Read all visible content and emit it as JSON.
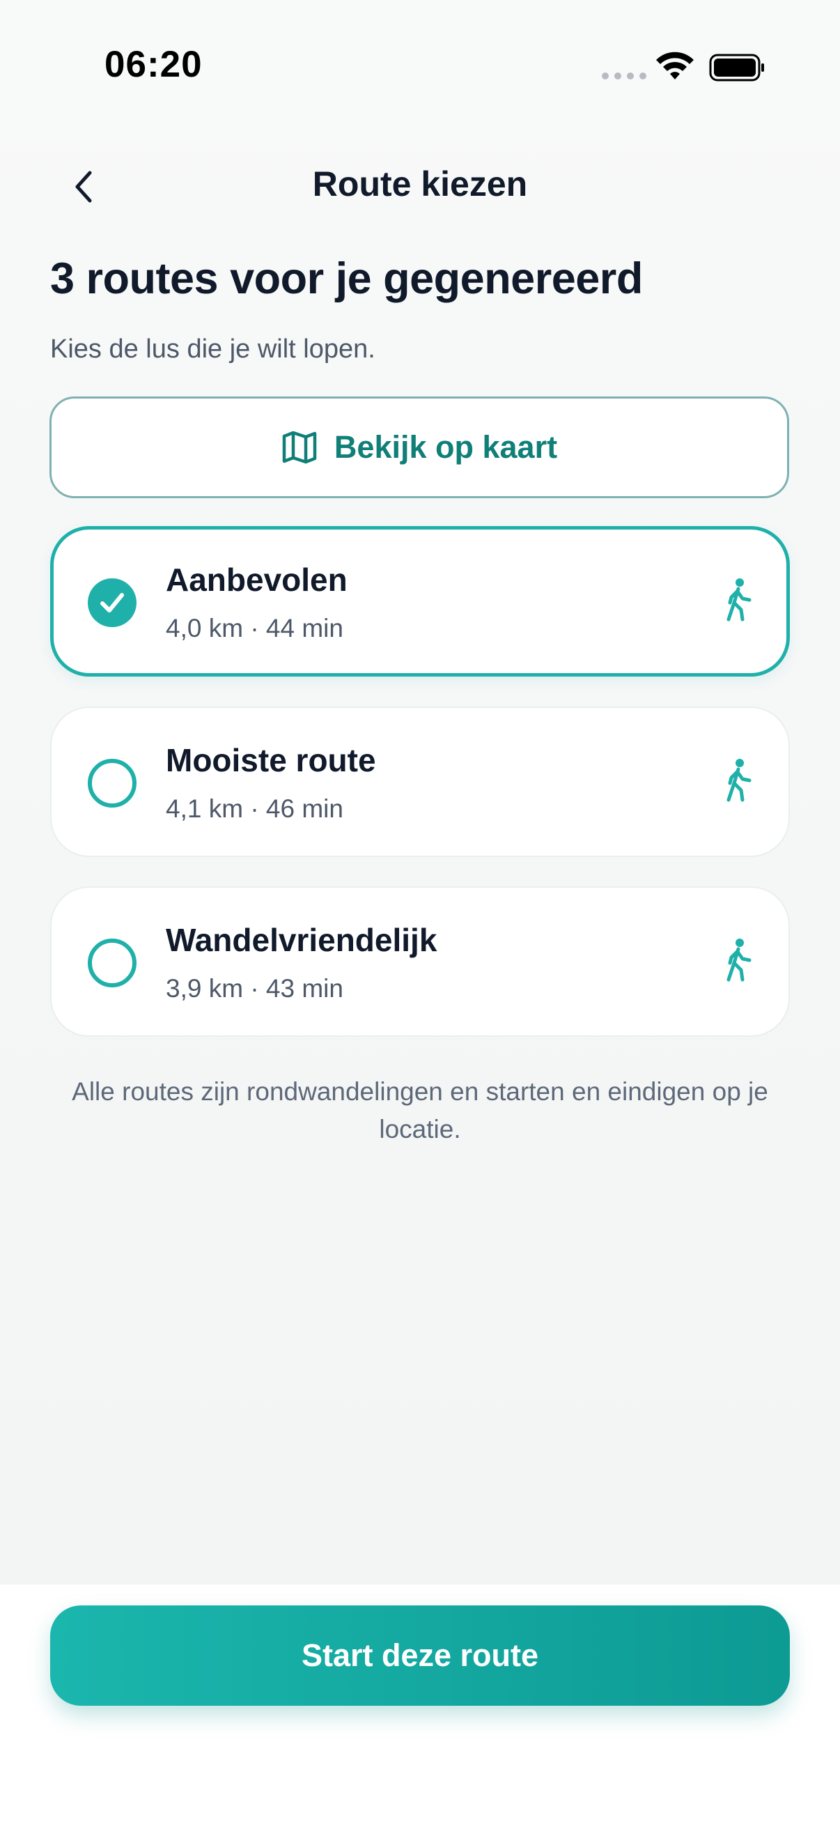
{
  "status_bar": {
    "time": "06:20"
  },
  "header": {
    "title": "Route kiezen"
  },
  "intro": {
    "heading": "3 routes voor je gegenereerd",
    "subtitle": "Kies de lus die je wilt lopen."
  },
  "map_button": {
    "label": "Bekijk op kaart",
    "icon": "map-icon"
  },
  "routes": [
    {
      "name": "Aanbevolen",
      "meta": "4,0 km · 44 min",
      "selected": true,
      "icon": "walking-person-icon"
    },
    {
      "name": "Mooiste route",
      "meta": "4,1 km · 46 min",
      "selected": false,
      "icon": "walking-person-icon"
    },
    {
      "name": "Wandelvriendelijk",
      "meta": "3,9 km · 43 min",
      "selected": false,
      "icon": "walking-person-icon"
    }
  ],
  "footnote": "Alle routes zijn rondwandelingen en starten en eindigen op je locatie.",
  "primary_action": {
    "label": "Start deze route"
  },
  "colors": {
    "accent": "#1fb0aa",
    "accent_dark": "#0f7f78",
    "text": "#111a2b",
    "muted": "#4d5868"
  }
}
